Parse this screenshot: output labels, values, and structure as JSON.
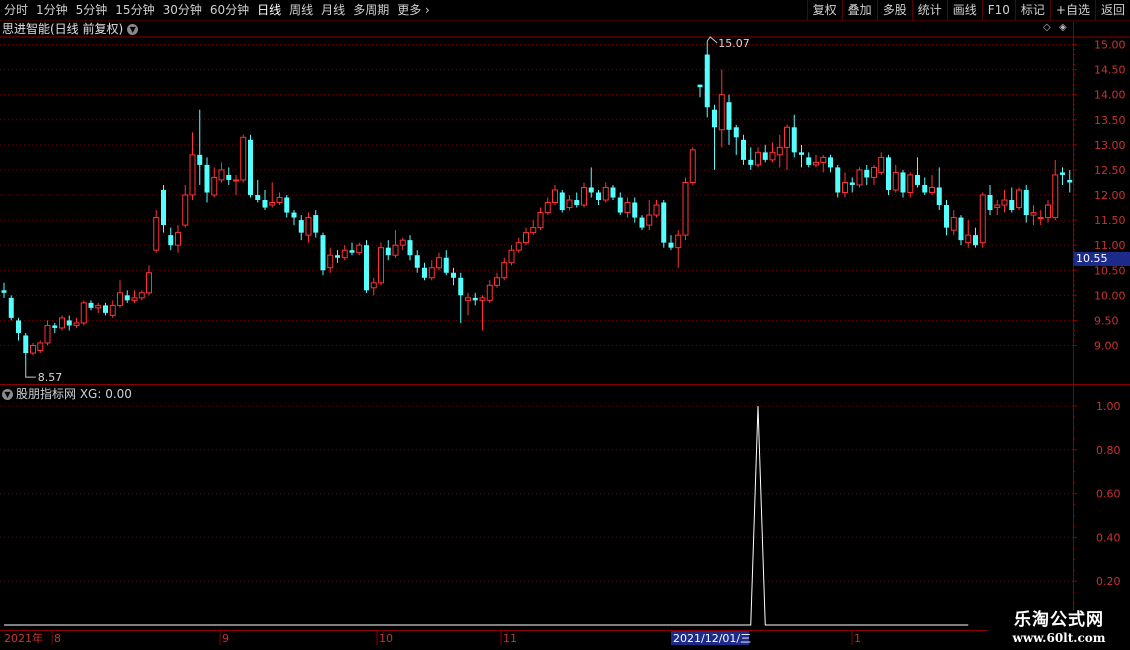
{
  "toolbar": {
    "period_tabs": [
      "分时",
      "1分钟",
      "5分钟",
      "15分钟",
      "30分钟",
      "60分钟",
      "日线",
      "周线",
      "月线",
      "多周期",
      "更多"
    ],
    "active_tab_index": 6,
    "right_buttons": [
      "复权",
      "叠加",
      "多股",
      "统计",
      "画线",
      "F10",
      "标记",
      "+自选",
      "返回"
    ]
  },
  "main_panel": {
    "title": "思进智能(日线 前复权)",
    "price_axis": [
      "15.00",
      "14.50",
      "14.00",
      "13.50",
      "13.00",
      "12.50",
      "12.00",
      "11.50",
      "11.00",
      "10.50",
      "10.00",
      "9.50",
      "9.00"
    ],
    "current_price_tag": "10.55",
    "high_label": "15.07",
    "low_label": "8.57"
  },
  "indicator_panel": {
    "title": "股朋指标网 XG: 0.00",
    "axis": [
      "1.00",
      "0.80",
      "0.60",
      "0.40",
      "0.20"
    ],
    "xg_signal_index": 104
  },
  "time_axis": {
    "labels": [
      "2021年",
      "8",
      "9",
      "10",
      "11",
      "2021/12/01/三",
      "1"
    ],
    "highlighted_label": "2021/12/01/三"
  },
  "watermark": {
    "line1": "乐淘公式网",
    "line2": "www.60lt.com"
  },
  "colors": {
    "up": "#ff3333",
    "down": "#54ffff",
    "grid": "#7a0000",
    "axis": "#8a0000",
    "xg_line": "#ffffff"
  },
  "chart_data": {
    "type": "candlestick",
    "y_range": [
      8.5,
      15.2
    ],
    "candles": [
      [
        10.1,
        10.05,
        10.25,
        9.95
      ],
      [
        9.95,
        9.55,
        10.0,
        9.5
      ],
      [
        9.5,
        9.25,
        9.55,
        9.1
      ],
      [
        9.2,
        8.85,
        9.25,
        8.57
      ],
      [
        8.85,
        9.0,
        9.05,
        8.8
      ],
      [
        8.9,
        9.05,
        9.1,
        8.85
      ],
      [
        9.05,
        9.4,
        9.5,
        9.0
      ],
      [
        9.4,
        9.35,
        9.45,
        9.25
      ],
      [
        9.35,
        9.55,
        9.6,
        9.3
      ],
      [
        9.5,
        9.4,
        9.6,
        9.3
      ],
      [
        9.4,
        9.45,
        9.55,
        9.35
      ],
      [
        9.45,
        9.85,
        9.9,
        9.4
      ],
      [
        9.85,
        9.75,
        9.9,
        9.7
      ],
      [
        9.75,
        9.8,
        9.85,
        9.65
      ],
      [
        9.8,
        9.65,
        9.85,
        9.6
      ],
      [
        9.6,
        9.8,
        9.9,
        9.55
      ],
      [
        9.8,
        10.05,
        10.3,
        9.75
      ],
      [
        10.0,
        9.9,
        10.1,
        9.85
      ],
      [
        9.9,
        9.95,
        10.1,
        9.85
      ],
      [
        9.95,
        10.05,
        10.1,
        9.9
      ],
      [
        10.05,
        10.45,
        10.6,
        10.0
      ],
      [
        10.9,
        11.55,
        11.7,
        10.85
      ],
      [
        12.1,
        11.4,
        12.2,
        11.25
      ],
      [
        11.2,
        11.0,
        11.35,
        10.9
      ],
      [
        11.0,
        11.25,
        11.4,
        10.85
      ],
      [
        11.4,
        12.0,
        12.2,
        11.35
      ],
      [
        12.0,
        12.8,
        13.25,
        11.9
      ],
      [
        12.8,
        12.6,
        13.7,
        12.2
      ],
      [
        12.6,
        12.05,
        12.75,
        11.85
      ],
      [
        12.0,
        12.35,
        12.55,
        11.95
      ],
      [
        12.3,
        12.5,
        12.65,
        12.25
      ],
      [
        12.4,
        12.3,
        12.55,
        12.2
      ],
      [
        12.3,
        12.3,
        12.4,
        12.0
      ],
      [
        12.3,
        13.15,
        13.2,
        12.25
      ],
      [
        13.1,
        12.0,
        13.2,
        11.95
      ],
      [
        12.0,
        11.9,
        12.3,
        11.85
      ],
      [
        11.9,
        11.75,
        12.1,
        11.7
      ],
      [
        11.8,
        11.85,
        12.25,
        11.75
      ],
      [
        11.85,
        11.95,
        12.05,
        11.8
      ],
      [
        11.95,
        11.65,
        12.0,
        11.55
      ],
      [
        11.65,
        11.55,
        11.7,
        11.4
      ],
      [
        11.5,
        11.25,
        11.6,
        11.1
      ],
      [
        11.2,
        11.55,
        11.65,
        11.05
      ],
      [
        11.6,
        11.25,
        11.7,
        11.15
      ],
      [
        11.2,
        10.5,
        11.25,
        10.4
      ],
      [
        10.55,
        10.8,
        10.95,
        10.45
      ],
      [
        10.8,
        10.75,
        10.9,
        10.65
      ],
      [
        10.75,
        10.9,
        11.0,
        10.7
      ],
      [
        10.9,
        10.85,
        11.05,
        10.8
      ],
      [
        10.85,
        11.0,
        11.05,
        10.8
      ],
      [
        11.0,
        10.1,
        11.1,
        10.05
      ],
      [
        10.15,
        10.25,
        10.35,
        10.0
      ],
      [
        10.25,
        10.95,
        11.05,
        10.2
      ],
      [
        10.95,
        10.8,
        11.1,
        10.7
      ],
      [
        10.8,
        11.0,
        11.3,
        10.75
      ],
      [
        11.0,
        11.1,
        11.15,
        10.9
      ],
      [
        11.1,
        10.8,
        11.2,
        10.7
      ],
      [
        10.8,
        10.55,
        10.9,
        10.45
      ],
      [
        10.55,
        10.35,
        10.65,
        10.3
      ],
      [
        10.35,
        10.55,
        10.7,
        10.3
      ],
      [
        10.55,
        10.75,
        10.85,
        10.5
      ],
      [
        10.75,
        10.45,
        10.9,
        10.4
      ],
      [
        10.45,
        10.35,
        10.55,
        10.2
      ],
      [
        10.35,
        10.0,
        10.45,
        9.45
      ],
      [
        9.9,
        9.95,
        10.05,
        9.6
      ],
      [
        9.95,
        9.9,
        10.05,
        9.8
      ],
      [
        9.9,
        9.95,
        10.0,
        9.3
      ],
      [
        9.9,
        10.2,
        10.3,
        9.85
      ],
      [
        10.2,
        10.35,
        10.45,
        10.15
      ],
      [
        10.35,
        10.65,
        10.75,
        10.3
      ],
      [
        10.65,
        10.9,
        11.0,
        10.6
      ],
      [
        10.9,
        11.05,
        11.15,
        10.85
      ],
      [
        11.05,
        11.25,
        11.35,
        11.0
      ],
      [
        11.25,
        11.35,
        11.5,
        11.2
      ],
      [
        11.35,
        11.65,
        11.75,
        11.3
      ],
      [
        11.65,
        11.85,
        11.95,
        11.6
      ],
      [
        11.85,
        12.1,
        12.2,
        11.8
      ],
      [
        12.05,
        11.7,
        12.1,
        11.65
      ],
      [
        11.75,
        11.9,
        12.0,
        11.7
      ],
      [
        11.9,
        11.8,
        12.05,
        11.75
      ],
      [
        11.8,
        12.15,
        12.25,
        11.75
      ],
      [
        12.15,
        12.05,
        12.55,
        11.95
      ],
      [
        12.05,
        11.9,
        12.1,
        11.8
      ],
      [
        11.9,
        12.15,
        12.25,
        11.85
      ],
      [
        12.15,
        11.95,
        12.2,
        11.9
      ],
      [
        11.95,
        11.65,
        12.05,
        11.6
      ],
      [
        11.65,
        11.85,
        11.95,
        11.55
      ],
      [
        11.85,
        11.55,
        11.95,
        11.45
      ],
      [
        11.55,
        11.35,
        11.6,
        11.3
      ],
      [
        11.4,
        11.6,
        11.9,
        11.3
      ],
      [
        11.6,
        11.8,
        11.9,
        11.55
      ],
      [
        11.85,
        11.05,
        11.9,
        10.95
      ],
      [
        11.05,
        10.95,
        11.2,
        10.9
      ],
      [
        10.95,
        11.2,
        11.3,
        10.55
      ],
      [
        11.2,
        12.25,
        12.35,
        11.1
      ],
      [
        12.25,
        12.9,
        12.95,
        12.2
      ],
      [
        14.2,
        14.15,
        14.2,
        13.95
      ],
      [
        14.8,
        13.75,
        15.07,
        13.55
      ],
      [
        13.7,
        13.35,
        13.8,
        12.5
      ],
      [
        13.3,
        14.0,
        14.5,
        12.95
      ],
      [
        13.85,
        13.3,
        14.0,
        13.0
      ],
      [
        13.35,
        13.15,
        13.4,
        12.8
      ],
      [
        13.1,
        12.7,
        13.2,
        12.6
      ],
      [
        12.7,
        12.6,
        12.95,
        12.5
      ],
      [
        12.6,
        12.85,
        12.95,
        12.55
      ],
      [
        12.85,
        12.7,
        13.0,
        12.65
      ],
      [
        12.7,
        12.85,
        13.05,
        12.65
      ],
      [
        12.8,
        12.95,
        13.2,
        12.55
      ],
      [
        12.95,
        13.35,
        13.4,
        12.5
      ],
      [
        13.35,
        12.85,
        13.6,
        12.75
      ],
      [
        12.85,
        12.8,
        13.0,
        12.55
      ],
      [
        12.75,
        12.6,
        12.85,
        12.55
      ],
      [
        12.6,
        12.65,
        12.8,
        12.55
      ],
      [
        12.65,
        12.75,
        12.8,
        12.45
      ],
      [
        12.75,
        12.55,
        12.8,
        12.45
      ],
      [
        12.55,
        12.05,
        12.6,
        11.95
      ],
      [
        12.05,
        12.25,
        12.45,
        11.95
      ],
      [
        12.25,
        12.2,
        12.35,
        12.05
      ],
      [
        12.2,
        12.5,
        12.55,
        12.15
      ],
      [
        12.5,
        12.35,
        12.6,
        12.2
      ],
      [
        12.35,
        12.55,
        12.6,
        12.2
      ],
      [
        12.45,
        12.75,
        12.85,
        12.4
      ],
      [
        12.75,
        12.1,
        12.8,
        12.0
      ],
      [
        12.1,
        12.45,
        12.6,
        12.05
      ],
      [
        12.45,
        12.05,
        12.5,
        11.95
      ],
      [
        12.05,
        12.4,
        12.45,
        11.95
      ],
      [
        12.4,
        12.2,
        12.75,
        12.15
      ],
      [
        12.2,
        12.05,
        12.35,
        12.0
      ],
      [
        12.05,
        12.15,
        12.4,
        12.0
      ],
      [
        12.15,
        11.8,
        12.55,
        11.7
      ],
      [
        11.8,
        11.35,
        11.9,
        11.2
      ],
      [
        11.3,
        11.55,
        11.7,
        11.2
      ],
      [
        11.55,
        11.1,
        11.6,
        11.0
      ],
      [
        11.05,
        11.2,
        11.5,
        10.95
      ],
      [
        11.2,
        11.0,
        11.35,
        10.95
      ],
      [
        11.05,
        12.0,
        12.05,
        10.95
      ],
      [
        12.0,
        11.7,
        12.2,
        11.6
      ],
      [
        11.75,
        11.8,
        11.9,
        11.6
      ],
      [
        11.8,
        11.9,
        12.1,
        11.65
      ],
      [
        11.9,
        11.7,
        12.15,
        11.65
      ],
      [
        11.75,
        12.1,
        12.15,
        11.7
      ],
      [
        12.1,
        11.6,
        12.2,
        11.45
      ],
      [
        11.6,
        11.65,
        11.8,
        11.4
      ],
      [
        11.55,
        11.55,
        11.7,
        11.4
      ],
      [
        11.55,
        11.8,
        11.9,
        11.45
      ],
      [
        11.55,
        12.4,
        12.7,
        11.5
      ],
      [
        12.45,
        12.4,
        12.55,
        12.2
      ],
      [
        12.3,
        12.25,
        12.5,
        12.05
      ]
    ]
  }
}
